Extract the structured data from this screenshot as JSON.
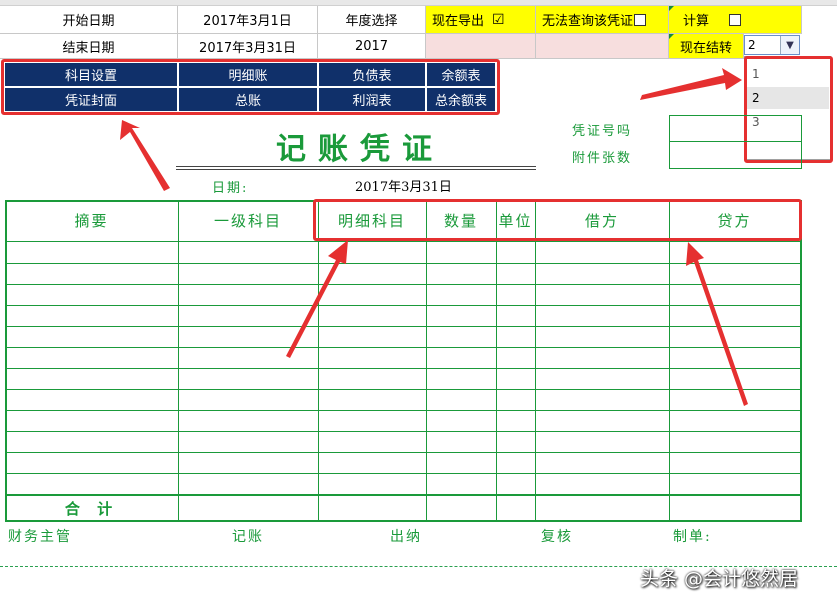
{
  "header": {
    "start_date_label": "开始日期",
    "start_date_value": "2017年3月1日",
    "end_date_label": "结束日期",
    "end_date_value": "2017年3月31日",
    "year_label": "年度选择",
    "year_value": "2017",
    "export_label": "现在导出",
    "export_checked": "☑",
    "cannot_query_label": "无法查询该凭证",
    "calc_label": "计算",
    "transfer_label": "现在结转",
    "transfer_value": "2",
    "dropdown_options": [
      "1",
      "2",
      "3"
    ],
    "dropdown_selected": "2"
  },
  "nav": {
    "row1": [
      "科目设置",
      "明细账",
      "负债表",
      "余额表"
    ],
    "row2": [
      "凭证封面",
      "总账",
      "利润表",
      "总余额表"
    ]
  },
  "voucher": {
    "title": "记账凭证",
    "voucher_no_label": "凭证号吗",
    "attachments_label": "附件张数",
    "date_label": "日期:",
    "date_value": "2017年3月31日",
    "columns": [
      "摘要",
      "一级科目",
      "明细科目",
      "数量",
      "单位",
      "借方",
      "贷方"
    ],
    "total_label": "合  计"
  },
  "footer": {
    "finance_manager": "财务主管",
    "bookkeeping": "记账",
    "cashier": "出纳",
    "review": "复核",
    "prepared_by": "制单:"
  },
  "watermark": "头条 @会计悠然居",
  "colors": {
    "nav_bg": "#10306a",
    "accent_green": "#1a9a3a",
    "highlight_yellow": "#ffff00",
    "annotation_red": "#e53030"
  }
}
